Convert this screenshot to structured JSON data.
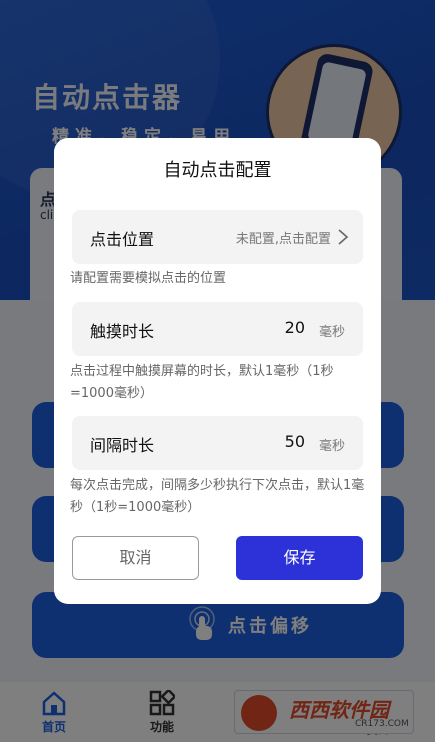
{
  "app": {
    "title": "自动点击器",
    "tagline": "精准，稳定，易用",
    "card": {
      "heading": "点",
      "subtext": "cli"
    },
    "features": [
      {
        "label": ""
      },
      {
        "label": ""
      },
      {
        "label": "点击偏移"
      }
    ],
    "tabs": [
      {
        "label": "首页",
        "active": true
      },
      {
        "label": "功能",
        "active": false
      },
      {
        "label": "我的",
        "active": false
      }
    ],
    "watermark": {
      "name": "西西软件园",
      "url": "CR173.COM"
    }
  },
  "dialog": {
    "title": "自动点击配置",
    "position": {
      "label": "点击位置",
      "value": "未配置,点击配置",
      "hint": "请配置需要模拟点击的位置"
    },
    "touch_duration": {
      "label": "触摸时长",
      "value": "20",
      "unit": "毫秒",
      "hint": "点击过程中触摸屏幕的时长，默认1毫秒（1秒=1000毫秒）"
    },
    "interval": {
      "label": "间隔时长",
      "value": "50",
      "unit": "毫秒",
      "hint": "每次点击完成，间隔多少秒执行下次点击，默认1毫秒（1秒=1000毫秒）"
    },
    "cancel_label": "取消",
    "save_label": "保存"
  },
  "colors": {
    "brand_blue": "#1d5fe0",
    "save_button": "#2c32d8",
    "row_bg": "#f3f3f3",
    "overlay": "rgba(0,0,0,0.5)"
  }
}
